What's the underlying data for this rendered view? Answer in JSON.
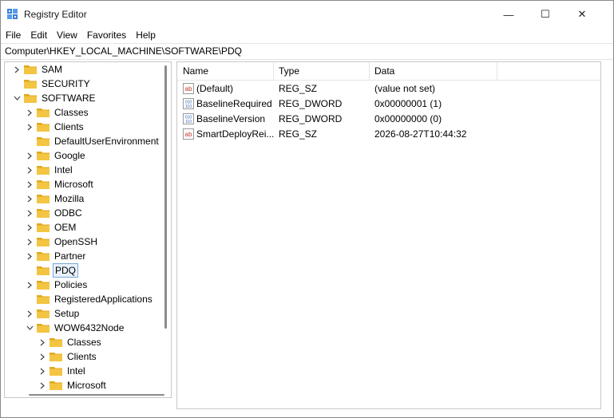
{
  "window": {
    "title": "Registry Editor",
    "controls": {
      "minimize": "—",
      "maximize": "☐",
      "close": "✕"
    }
  },
  "menu": [
    "File",
    "Edit",
    "View",
    "Favorites",
    "Help"
  ],
  "address": "Computer\\HKEY_LOCAL_MACHINE\\SOFTWARE\\PDQ",
  "tree": [
    {
      "label": "SAM",
      "depth": 0,
      "chevron": "right"
    },
    {
      "label": "SECURITY",
      "depth": 0,
      "chevron": "none"
    },
    {
      "label": "SOFTWARE",
      "depth": 0,
      "chevron": "down"
    },
    {
      "label": "Classes",
      "depth": 1,
      "chevron": "right"
    },
    {
      "label": "Clients",
      "depth": 1,
      "chevron": "right"
    },
    {
      "label": "DefaultUserEnvironment",
      "depth": 1,
      "chevron": "none"
    },
    {
      "label": "Google",
      "depth": 1,
      "chevron": "right"
    },
    {
      "label": "Intel",
      "depth": 1,
      "chevron": "right"
    },
    {
      "label": "Microsoft",
      "depth": 1,
      "chevron": "right"
    },
    {
      "label": "Mozilla",
      "depth": 1,
      "chevron": "right"
    },
    {
      "label": "ODBC",
      "depth": 1,
      "chevron": "right"
    },
    {
      "label": "OEM",
      "depth": 1,
      "chevron": "right"
    },
    {
      "label": "OpenSSH",
      "depth": 1,
      "chevron": "right"
    },
    {
      "label": "Partner",
      "depth": 1,
      "chevron": "right"
    },
    {
      "label": "PDQ",
      "depth": 1,
      "chevron": "none",
      "selected": true
    },
    {
      "label": "Policies",
      "depth": 1,
      "chevron": "right"
    },
    {
      "label": "RegisteredApplications",
      "depth": 1,
      "chevron": "none"
    },
    {
      "label": "Setup",
      "depth": 1,
      "chevron": "right"
    },
    {
      "label": "WOW6432Node",
      "depth": 1,
      "chevron": "down"
    },
    {
      "label": "Classes",
      "depth": 2,
      "chevron": "right"
    },
    {
      "label": "Clients",
      "depth": 2,
      "chevron": "right"
    },
    {
      "label": "Intel",
      "depth": 2,
      "chevron": "right"
    },
    {
      "label": "Microsoft",
      "depth": 2,
      "chevron": "right"
    }
  ],
  "list": {
    "columns": [
      "Name",
      "Type",
      "Data"
    ],
    "rows": [
      {
        "icon": "string-value-icon",
        "name": "(Default)",
        "type": "REG_SZ",
        "data": "(value not set)"
      },
      {
        "icon": "dword-value-icon",
        "name": "BaselineRequired",
        "type": "REG_DWORD",
        "data": "0x00000001 (1)"
      },
      {
        "icon": "dword-value-icon",
        "name": "BaselineVersion",
        "type": "REG_DWORD",
        "data": "0x00000000 (0)"
      },
      {
        "icon": "string-value-icon",
        "name": "SmartDeployRei...",
        "type": "REG_SZ",
        "data": "2026-08-27T10:44:32"
      }
    ]
  },
  "colors": {
    "folder": "#f4c542",
    "folder_dark": "#e0a81e",
    "selection_border": "#7aa7d8",
    "string_icon": "#c0392b",
    "dword_icon": "#2a5db0"
  }
}
